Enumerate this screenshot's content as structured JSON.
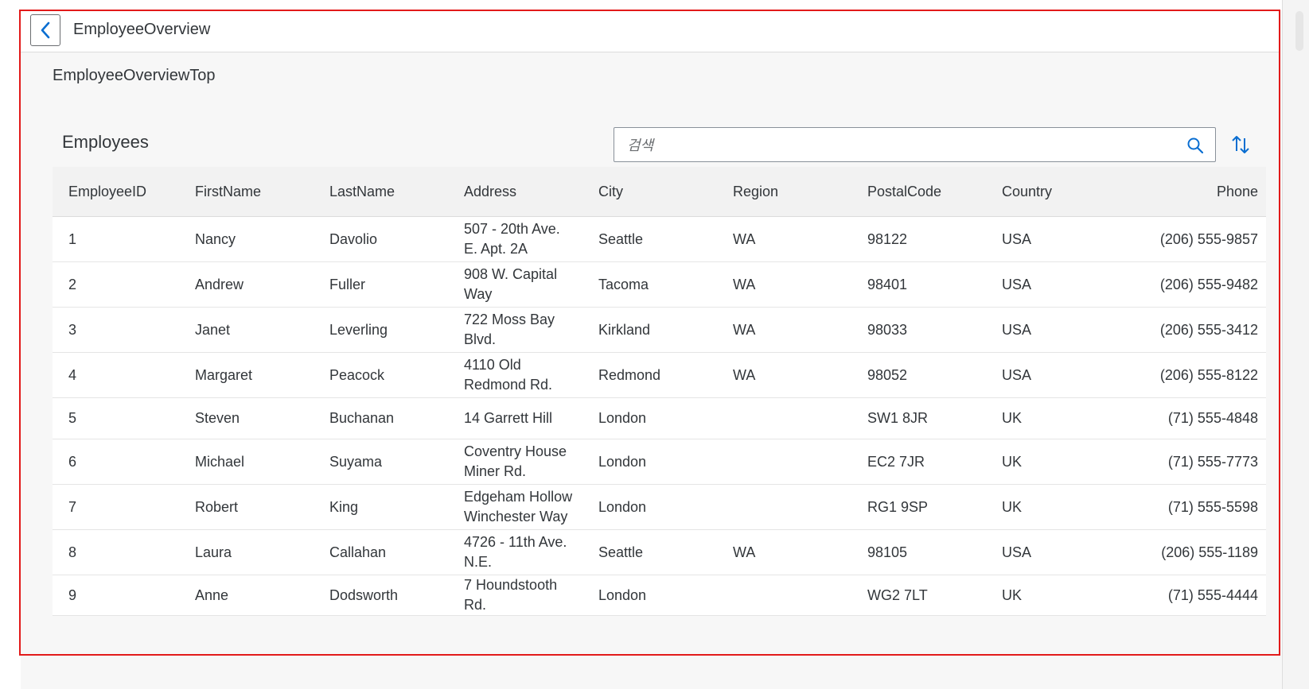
{
  "header": {
    "title": "EmployeeOverview",
    "back_icon": "chevron-left-icon"
  },
  "section": {
    "title": "EmployeeOverviewTop"
  },
  "table": {
    "title": "Employees",
    "search_placeholder": "검색",
    "columns": [
      "EmployeeID",
      "FirstName",
      "LastName",
      "Address",
      "City",
      "Region",
      "PostalCode",
      "Country",
      "Phone"
    ],
    "rows": [
      [
        "1",
        "Nancy",
        "Davolio",
        "507 - 20th Ave. E. Apt. 2A",
        "Seattle",
        "WA",
        "98122",
        "USA",
        "(206) 555-9857"
      ],
      [
        "2",
        "Andrew",
        "Fuller",
        "908 W. Capital Way",
        "Tacoma",
        "WA",
        "98401",
        "USA",
        "(206) 555-9482"
      ],
      [
        "3",
        "Janet",
        "Leverling",
        "722 Moss Bay Blvd.",
        "Kirkland",
        "WA",
        "98033",
        "USA",
        "(206) 555-3412"
      ],
      [
        "4",
        "Margaret",
        "Peacock",
        "4110 Old Redmond Rd.",
        "Redmond",
        "WA",
        "98052",
        "USA",
        "(206) 555-8122"
      ],
      [
        "5",
        "Steven",
        "Buchanan",
        "14 Garrett Hill",
        "London",
        "",
        "SW1 8JR",
        "UK",
        "(71) 555-4848"
      ],
      [
        "6",
        "Michael",
        "Suyama",
        "Coventry House Miner Rd.",
        "London",
        "",
        "EC2 7JR",
        "UK",
        "(71) 555-7773"
      ],
      [
        "7",
        "Robert",
        "King",
        "Edgeham Hollow Winchester Way",
        "London",
        "",
        "RG1 9SP",
        "UK",
        "(71) 555-5598"
      ],
      [
        "8",
        "Laura",
        "Callahan",
        "4726 - 11th Ave. N.E.",
        "Seattle",
        "WA",
        "98105",
        "USA",
        "(206) 555-1189"
      ],
      [
        "9",
        "Anne",
        "Dodsworth",
        "7 Houndstooth Rd.",
        "London",
        "",
        "WG2 7LT",
        "UK",
        "(71) 555-4444"
      ]
    ]
  },
  "colors": {
    "accent": "#0a6ed1",
    "highlight_border": "#e21a1a",
    "text": "#32363a"
  }
}
